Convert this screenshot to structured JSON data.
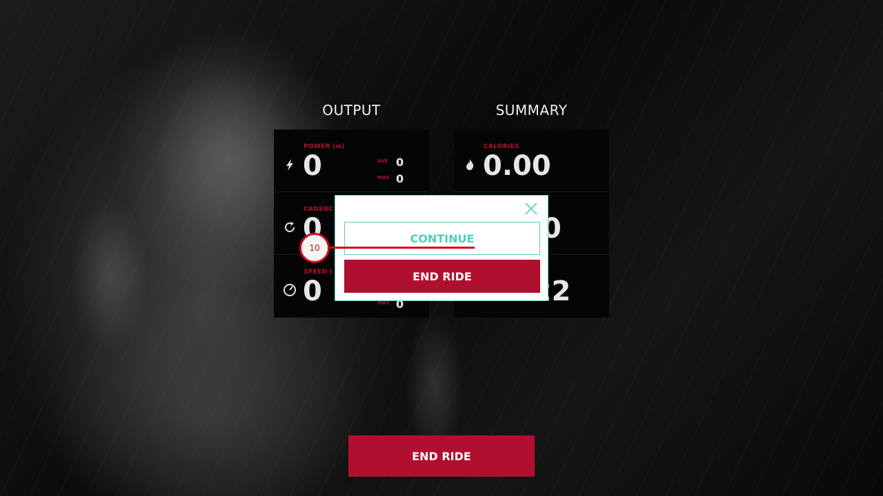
{
  "output": {
    "title": "OUTPUT",
    "power": {
      "label": "POWER (w)",
      "value": "0",
      "ave_label": "AVE",
      "ave_value": "0",
      "max_label": "MAX",
      "max_value": "0",
      "icon": "lightning-icon"
    },
    "cadence": {
      "label": "CADENC",
      "value": "0",
      "icon": "refresh-icon"
    },
    "speed": {
      "label": "SPEED (",
      "value": "0",
      "max_label": "MAX",
      "max_value": "0",
      "icon": "speedometer-icon"
    }
  },
  "summary": {
    "title": "SUMMARY",
    "calories": {
      "label": "CALORIES",
      "value": "0.00",
      "icon": "flame-icon"
    },
    "middle": {
      "value": "0"
    },
    "time": {
      "value": "00:22"
    }
  },
  "modal": {
    "continue_label": "CONTINUE",
    "end_ride_label": "END RIDE",
    "close_icon": "close-icon"
  },
  "footer": {
    "end_ride_label": "END RIDE"
  },
  "annotation": {
    "marker_number": "10"
  },
  "colors": {
    "accent_red": "#b0102f",
    "accent_teal": "#4fd1b7"
  }
}
